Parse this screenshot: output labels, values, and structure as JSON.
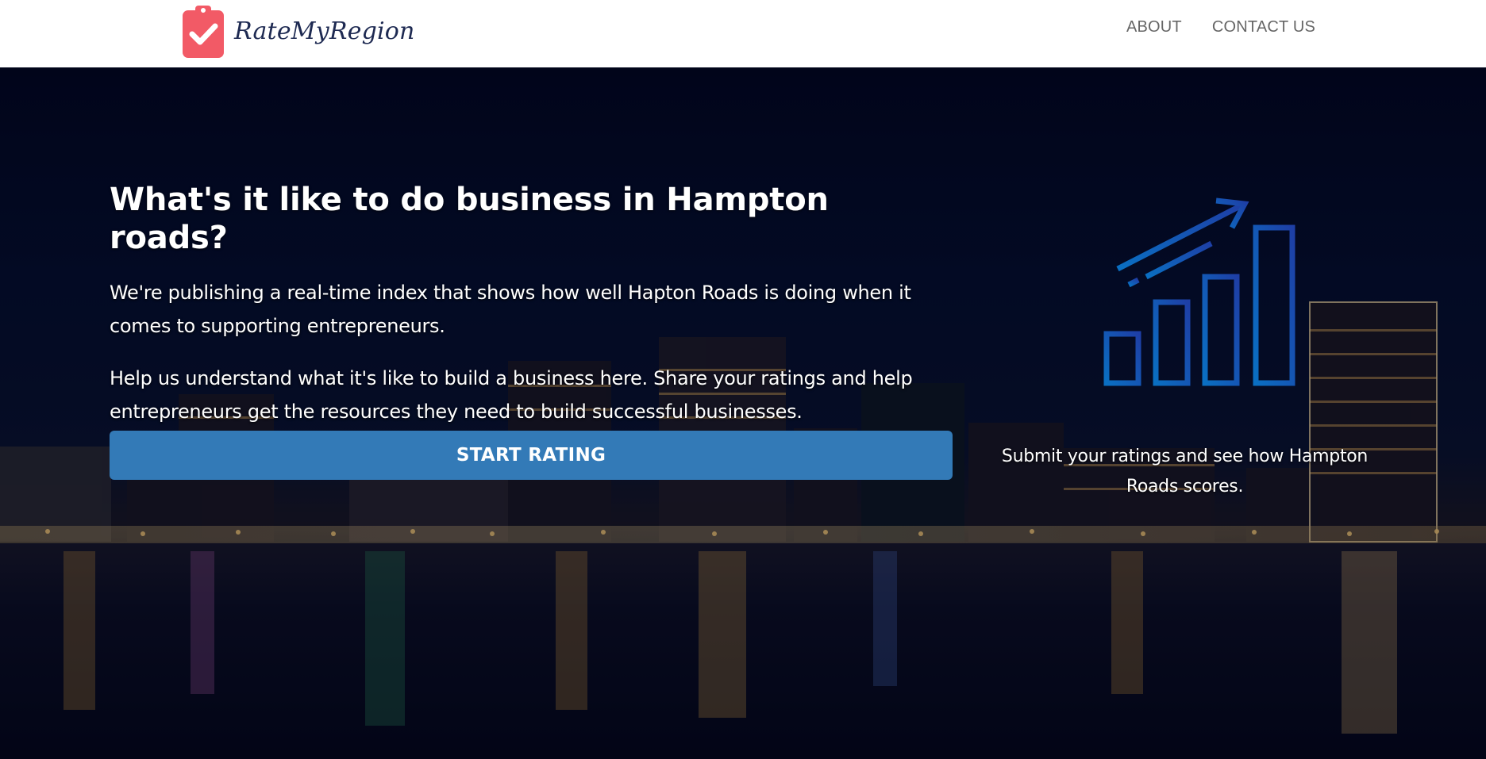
{
  "app": {
    "brand_name": "RateMyRegion",
    "logo_icon": "clipboard-check-icon",
    "brand_color": "#f25a66"
  },
  "nav": {
    "items": [
      {
        "label": "ABOUT"
      },
      {
        "label": "CONTACT US"
      }
    ]
  },
  "hero": {
    "title": "What's it like to do business in Hampton roads?",
    "paragraph_1": "We're publishing a real-time index that shows how well Hapton Roads is doing when it comes to supporting entrepreneurs.",
    "paragraph_2": "Help us understand what it's like to build a business here. Share your ratings and help entrepreneurs get the resources they need to build successful businesses.",
    "cta_label": "START RATING",
    "cta_color": "#337ab7",
    "illustration_icon": "growth-chart-icon",
    "caption": "Submit your ratings and see how Hampton Roads scores.",
    "background": "night-city-skyline-over-water"
  }
}
